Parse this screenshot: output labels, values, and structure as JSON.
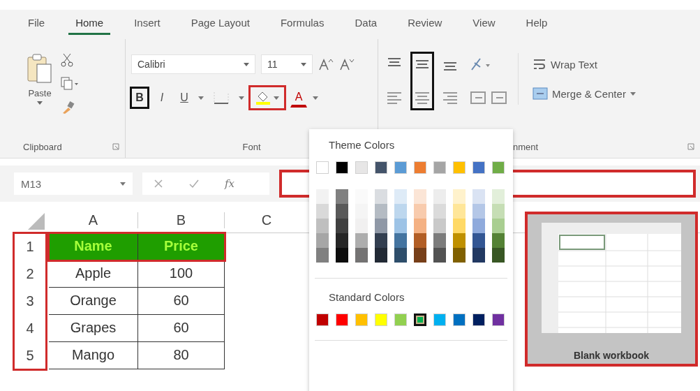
{
  "tabs": [
    {
      "label": "File",
      "selected": false
    },
    {
      "label": "Home",
      "selected": true
    },
    {
      "label": "Insert",
      "selected": false
    },
    {
      "label": "Page Layout",
      "selected": false
    },
    {
      "label": "Formulas",
      "selected": false
    },
    {
      "label": "Data",
      "selected": false
    },
    {
      "label": "Review",
      "selected": false
    },
    {
      "label": "View",
      "selected": false
    },
    {
      "label": "Help",
      "selected": false
    }
  ],
  "clipboard": {
    "paste_label": "Paste",
    "group_label": "Clipboard"
  },
  "font": {
    "name": "Calibri",
    "size": "11",
    "group_label": "Font",
    "buttons": [
      {
        "kind": "bold",
        "label": "B",
        "highlighted": true,
        "color": "#111111"
      },
      {
        "kind": "italic",
        "label": "I",
        "highlighted": false
      },
      {
        "kind": "underline",
        "label": "U",
        "highlighted": false
      },
      {
        "kind": "border",
        "highlighted": false
      },
      {
        "kind": "fill",
        "highlighted": true,
        "color": "#d02b2b"
      },
      {
        "kind": "font-color",
        "label": "A",
        "highlighted": false
      }
    ]
  },
  "alignment": {
    "group_label": "nment",
    "wrap_text": "Wrap Text",
    "merge_center": "Merge & Center",
    "columns": [
      {
        "highlighted": false
      },
      {
        "highlighted": true,
        "color": "#111111"
      },
      {
        "highlighted": false
      }
    ]
  },
  "formula_bar": {
    "name_box": "M13",
    "fx": "fx",
    "highlighted": true,
    "color": "#d02b2b"
  },
  "sheet": {
    "columns": [
      "A",
      "B",
      "C"
    ],
    "row_headers_highlight": {
      "highlighted": true,
      "color": "#d02b2b"
    },
    "rows": [
      {
        "number": "1",
        "kind": "header",
        "highlighted": true,
        "color": "#d02b2b",
        "cells": [
          "Name",
          "Price"
        ]
      },
      {
        "number": "2",
        "kind": "data",
        "highlighted": false,
        "cells": [
          "Apple",
          "100"
        ]
      },
      {
        "number": "3",
        "kind": "data",
        "highlighted": false,
        "cells": [
          "Orange",
          "60"
        ]
      },
      {
        "number": "4",
        "kind": "data",
        "highlighted": false,
        "cells": [
          "Grapes",
          "60"
        ]
      },
      {
        "number": "5",
        "kind": "data",
        "highlighted": false,
        "cells": [
          "Mango",
          "80"
        ]
      }
    ]
  },
  "color_menu": {
    "theme_title": "Theme Colors",
    "standard_title": "Standard Colors",
    "theme": [
      {
        "color": "#ffffff",
        "selected": false
      },
      {
        "color": "#000000",
        "selected": false
      },
      {
        "color": "#e7e6e6",
        "selected": false
      },
      {
        "color": "#44546a",
        "selected": false
      },
      {
        "color": "#5b9bd5",
        "selected": false
      },
      {
        "color": "#ed7d31",
        "selected": false
      },
      {
        "color": "#a5a5a5",
        "selected": false
      },
      {
        "color": "#ffc000",
        "selected": false
      },
      {
        "color": "#4472c4",
        "selected": false
      },
      {
        "color": "#70ad47",
        "selected": false
      }
    ],
    "standard": [
      {
        "color": "#c00000",
        "selected": false
      },
      {
        "color": "#ff0000",
        "selected": false
      },
      {
        "color": "#ffc000",
        "selected": false
      },
      {
        "color": "#ffff00",
        "selected": false
      },
      {
        "color": "#92d050",
        "selected": false
      },
      {
        "color": "#00b050",
        "selected": true
      },
      {
        "color": "#00b0f0",
        "selected": false
      },
      {
        "color": "#0070c0",
        "selected": false
      },
      {
        "color": "#002060",
        "selected": false
      },
      {
        "color": "#7030a0",
        "selected": false
      }
    ]
  },
  "template": {
    "label": "Blank workbook",
    "highlighted": true,
    "color": "#d02b2b"
  }
}
